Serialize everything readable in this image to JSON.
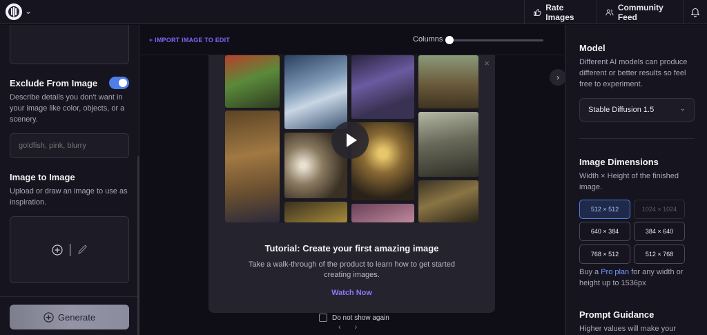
{
  "topbar": {
    "rate_label": "Rate Images",
    "community_label": "Community Feed"
  },
  "left": {
    "exclude_title": "Exclude From Image",
    "exclude_toggle_on": true,
    "exclude_desc": "Describe details you don't want in your image like color, objects, or a scenery.",
    "exclude_placeholder": "goldfish, pink, blurry",
    "img2img_title": "Image to Image",
    "img2img_desc": "Upload or draw an image to use as inspiration.",
    "generate_label": "Generate"
  },
  "center": {
    "import_label": "+ IMPORT IMAGE TO EDIT",
    "columns_label": "Columns",
    "columns_value": 0,
    "modal": {
      "title": "Tutorial: Create your first amazing image",
      "description": "Take a walk-through of the product to learn how to get started creating images.",
      "watch_label": "Watch Now"
    },
    "dont_show_label": "Do not show again",
    "dont_show_checked": false,
    "pager_prev": "‹",
    "pager_next": "›"
  },
  "right": {
    "model_title": "Model",
    "model_desc": "Different AI models can produce different or better results so feel free to experiment.",
    "model_selected": "Stable Diffusion 1.5",
    "dimensions_title": "Image Dimensions",
    "dimensions_desc": "Width × Height of the finished image.",
    "dimensions": [
      {
        "label": "512 × 512",
        "state": "selected"
      },
      {
        "label": "1024 × 1024",
        "state": "disabled"
      },
      {
        "label": "640 × 384",
        "state": "normal"
      },
      {
        "label": "384 × 640",
        "state": "normal"
      },
      {
        "label": "768 × 512",
        "state": "normal"
      },
      {
        "label": "512 × 768",
        "state": "normal"
      }
    ],
    "pro_prefix": "Buy a ",
    "pro_link": "Pro plan",
    "pro_suffix": " for any width or height up to 1536px",
    "guidance_title": "Prompt Guidance",
    "guidance_desc": "Higher values will make your"
  },
  "colors": {
    "accent": "#7a66f0",
    "toggle_on": "#4f7dea",
    "background": "#0f0e17",
    "panel": "#16151f"
  }
}
